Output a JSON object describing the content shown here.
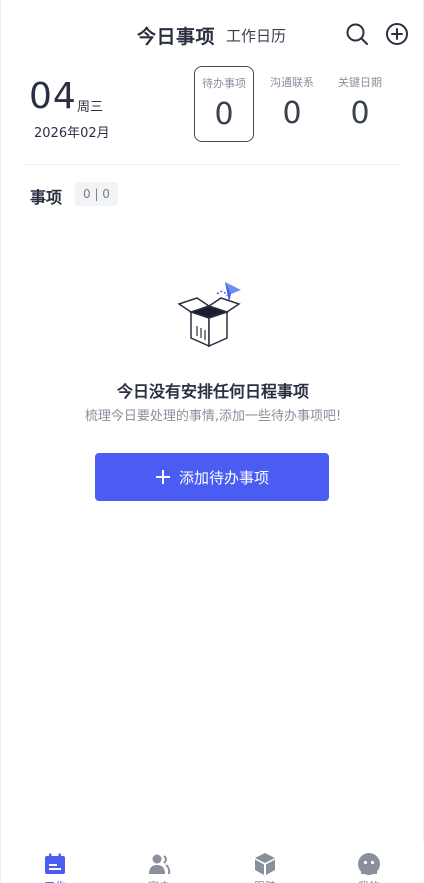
{
  "header": {
    "title": "今日事项",
    "calendar_tab": "工作日历",
    "search_icon": "search-icon",
    "add_icon": "plus-circle-icon"
  },
  "date": {
    "day": "04",
    "weekday": "周三",
    "month": "2026年02月"
  },
  "stats": [
    {
      "label": "待办事项",
      "value": "0",
      "active": true
    },
    {
      "label": "沟通联系",
      "value": "0",
      "active": false
    },
    {
      "label": "关键日期",
      "value": "0",
      "active": false
    }
  ],
  "section": {
    "title": "事项",
    "count": "0 | 0"
  },
  "empty_state": {
    "title": "今日没有安排任何日程事项",
    "subtitle": "梳理今日要处理的事情,添加一些待办事项吧!",
    "button_label": "添加待办事项"
  },
  "tabbar": [
    {
      "label": "工作",
      "icon": "calendar-icon",
      "active": true
    },
    {
      "label": "客户",
      "icon": "contacts-icon",
      "active": false
    },
    {
      "label": "跟踪",
      "icon": "box-icon",
      "active": false
    },
    {
      "label": "我的",
      "icon": "profile-icon",
      "active": false
    }
  ],
  "colors": {
    "accent": "#4a5cf2",
    "text": "#2b3040",
    "muted": "#8a8f9c"
  }
}
